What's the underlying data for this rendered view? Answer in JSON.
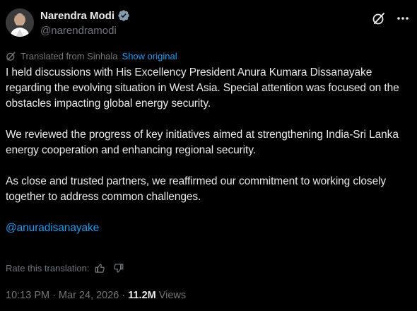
{
  "author": {
    "display_name": "Narendra Modi",
    "handle": "@narendramodi",
    "verified_color": "#829aab"
  },
  "actions": {
    "grok_icon": "grok-slash-icon",
    "more_icon": "more-dots-icon"
  },
  "translation": {
    "label": "Translated from Sinhala",
    "show_original": "Show original"
  },
  "body": {
    "paragraphs": [
      "I held discussions with His Excellency President Anura Kumara Dissanayake regarding the evolving situation in West Asia. Special attention was focused on the obstacles impacting global energy security.",
      "We reviewed the progress of key initiatives aimed at strengthening India-Sri Lanka energy cooperation and enhancing regional security.",
      "As close and trusted partners, we reaffirmed our commitment to working closely together to address common challenges."
    ],
    "mention": "@anuradisanayake"
  },
  "rating": {
    "label": "Rate this translation:"
  },
  "meta": {
    "time": "10:13 PM",
    "separator": "·",
    "date": "Mar 24, 2026",
    "views_count": "11.2M",
    "views_label": "Views"
  },
  "colors": {
    "background": "#000000",
    "text": "#e7e9ea",
    "muted": "#71767b",
    "link": "#1d9bf0"
  }
}
